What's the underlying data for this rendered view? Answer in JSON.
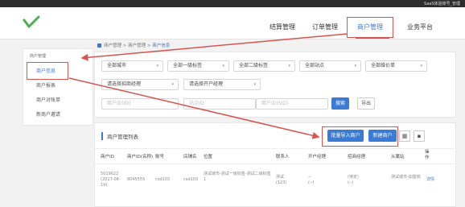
{
  "topbar": {
    "user": "SaaS体验账号_管理"
  },
  "nav": [
    {
      "label": "结算管理"
    },
    {
      "label": "订单管理"
    },
    {
      "label": "商户管理"
    },
    {
      "label": "业务平台"
    }
  ],
  "sidebar": {
    "group": "商户管理",
    "items": [
      {
        "label": "商户信息"
      },
      {
        "label": "商户报表"
      },
      {
        "label": "商户对账单"
      },
      {
        "label": "新商户邀请"
      }
    ]
  },
  "breadcrumb": {
    "root": "商户管理",
    "mid": "商户管理",
    "current": "商户信息",
    "sep": ">"
  },
  "filters": {
    "row1": [
      "全部城市",
      "全部一级标签",
      "全部二级标签",
      "全部站点",
      "全部维价单"
    ],
    "row2": [
      "请选择招商经理",
      "请选择开户经理"
    ],
    "inputs": [
      "商户ID(ID)",
      "站点ID",
      "商户ID(SID)"
    ],
    "search": "搜索",
    "export": "导出"
  },
  "list": {
    "title": "商户管理列表",
    "import_btn": "批量导入商户",
    "new_btn": "新建商户",
    "view_grid": "▦",
    "view_list": "▪",
    "columns": [
      "商户ID",
      "商户ID(名称)",
      "账号",
      "店铺名",
      "位置",
      "联系人",
      "开户经理",
      "招商经理",
      "从属站",
      "操作"
    ],
    "row": {
      "id": "5019622",
      "id_date": "(2017-08-19)",
      "mid": "8045555",
      "account": "csd103",
      "store": "csd103",
      "location": "测试城市-测试一级标签-测试二级标签",
      "location_tail": "1",
      "contact": "测试",
      "contact_sub": "(123)",
      "open_mgr": "--",
      "open_mgr_sub": "(--)",
      "invest_mgr": "(待定)",
      "invest_mgr_sub": "(--)",
      "site": "测试城市-加盟商",
      "action": "详情"
    }
  }
}
